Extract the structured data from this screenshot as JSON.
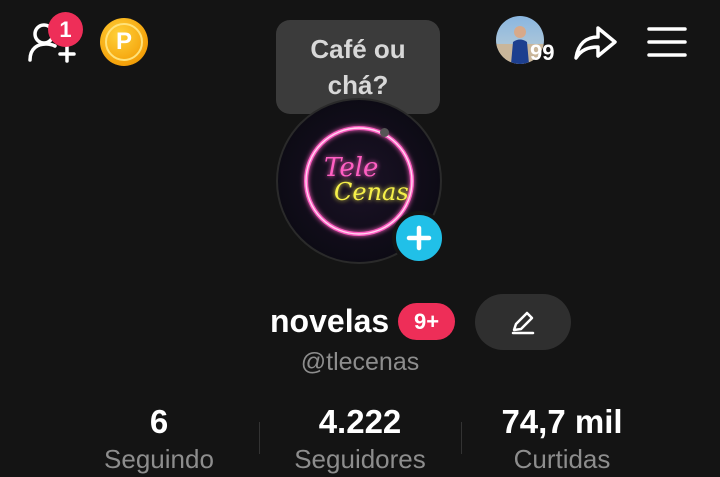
{
  "header": {
    "notification_count": "1",
    "coin_letter": "P",
    "story_count": "99"
  },
  "tooltip": {
    "line1": "Café ou",
    "line2": "chá?"
  },
  "avatar": {
    "logo_line1": "Tele",
    "logo_line2": "Cenas"
  },
  "profile": {
    "display_name": "novelas",
    "name_badge": "9+",
    "username": "@tlecenas"
  },
  "stats": [
    {
      "value": "6",
      "label": "Seguindo"
    },
    {
      "value": "4.222",
      "label": "Seguidores"
    },
    {
      "value": "74,7 mil",
      "label": "Curtidas"
    }
  ],
  "colors": {
    "background": "#141414",
    "badge_red": "#ee2e58",
    "add_blue": "#21c0e8",
    "coin_gold": "#f4a10a",
    "neon_pink": "#ff3fb4",
    "neon_yellow": "#f6f04a"
  },
  "icons": [
    "add-friend-icon",
    "coin-icon",
    "share-icon",
    "menu-icon",
    "plus-icon",
    "edit-pencil-icon"
  ]
}
